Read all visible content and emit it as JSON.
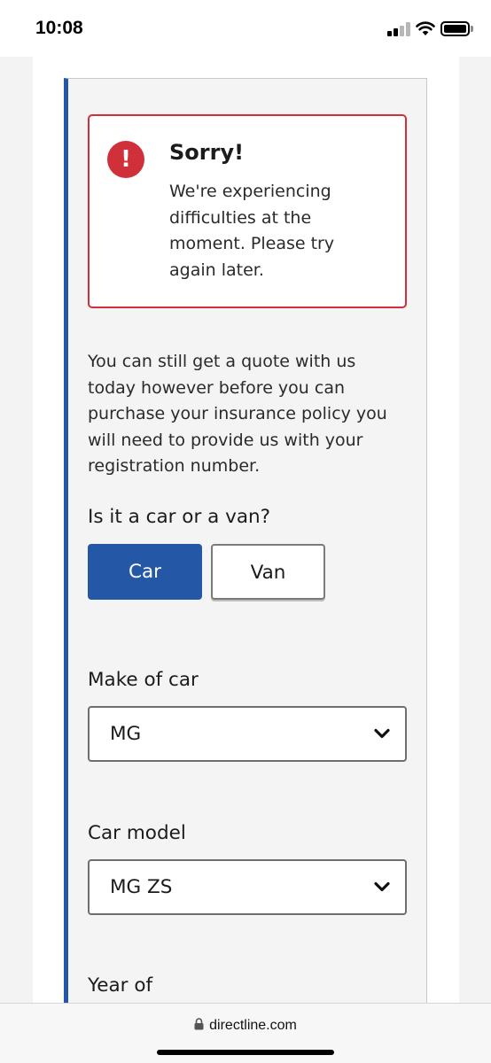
{
  "status_bar": {
    "time": "10:08",
    "icons": [
      "signal-icon",
      "wifi-icon",
      "battery-icon"
    ]
  },
  "error": {
    "icon": "exclamation-icon",
    "icon_glyph": "!",
    "title": "Sorry!",
    "message": "We're experiencing difficulties at the moment. Please try again later."
  },
  "intro": "You can still get a quote with us today however before you can purchase your insurance policy you will need to provide us with your registration number.",
  "vehicle_type": {
    "question": "Is it a car or a van?",
    "options": [
      "Car",
      "Van"
    ],
    "selected": "Car"
  },
  "make": {
    "label": "Make of car",
    "value": "MG"
  },
  "model": {
    "label": "Car model",
    "value": "MG ZS"
  },
  "year": {
    "label": "Year of"
  },
  "browser": {
    "url": "directline.com"
  },
  "colors": {
    "accent": "#2557a7",
    "error": "#d0303a",
    "background": "#f4f4f5"
  }
}
